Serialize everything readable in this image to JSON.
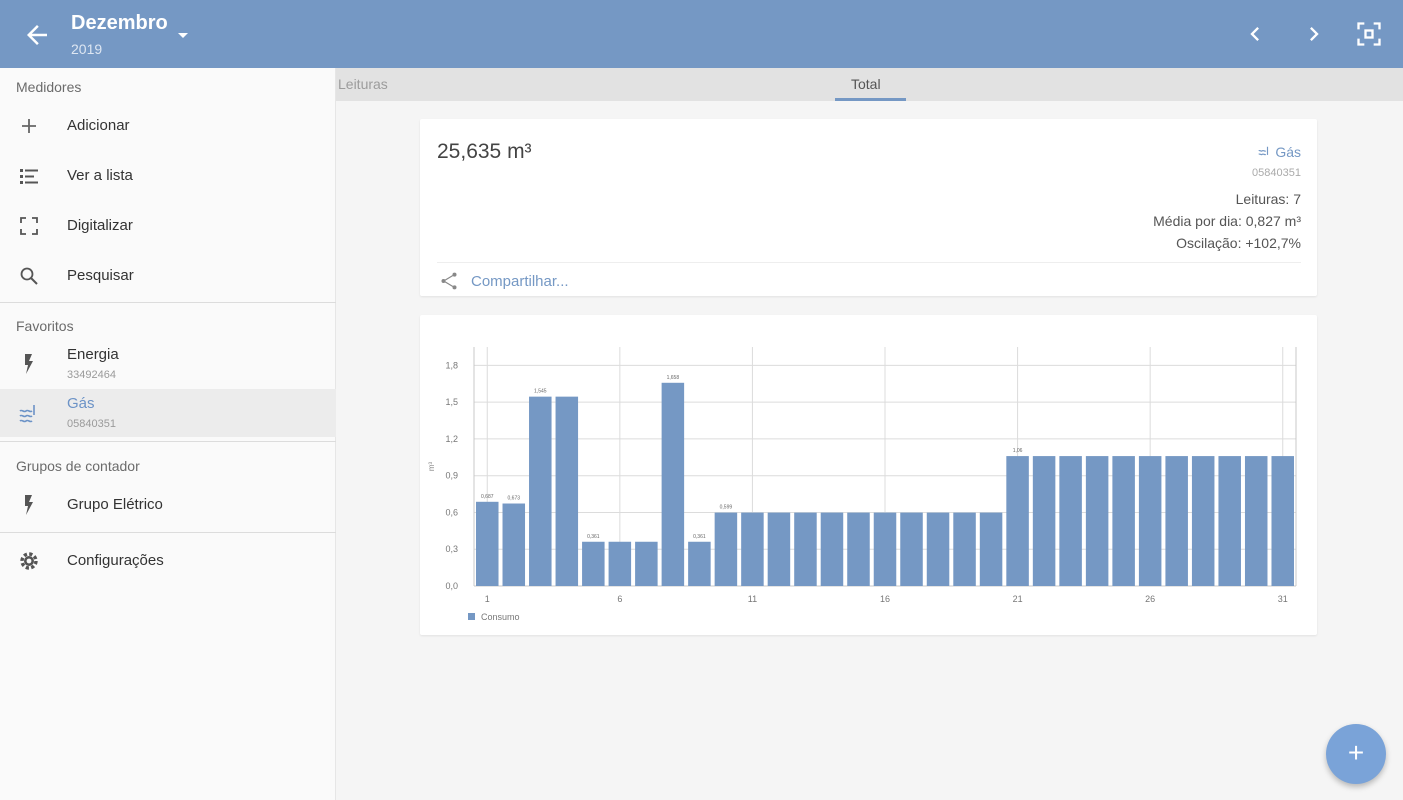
{
  "appbar": {
    "title": "Dezembro",
    "subtitle": "2019",
    "back_icon": "arrow-back-icon",
    "dropdown_icon": "arrow-drop-down-icon",
    "actions": [
      "chevron-left-icon",
      "chevron-right-icon",
      "scan-icon"
    ],
    "color": "#7598c4"
  },
  "drawer": {
    "meters_label": "Medidores",
    "meters_items": [
      {
        "label": "Adicionar",
        "icon": "plus-icon"
      },
      {
        "label": "Ver a lista",
        "icon": "list-icon"
      },
      {
        "label": "Digitalizar",
        "icon": "scan-frame-icon"
      },
      {
        "label": "Pesquisar",
        "icon": "search-icon"
      }
    ],
    "favorites_label": "Favoritos",
    "favorites": [
      {
        "label": "Energia",
        "sub": "33492464",
        "icon": "bolt-icon",
        "active": false
      },
      {
        "label": "Gás",
        "sub": "05840351",
        "icon": "gas-icon",
        "active": true
      }
    ],
    "groups_label": "Grupos de contador",
    "groups": [
      {
        "label": "Grupo Elétrico",
        "icon": "bolt-icon"
      }
    ],
    "settings": {
      "label": "Configurações",
      "icon": "gear-icon"
    }
  },
  "tabs": [
    {
      "label": "Leituras",
      "active": false
    },
    {
      "label": "Total",
      "active": true
    }
  ],
  "summary": {
    "total": "25,635 m³",
    "meter_type": "Gás",
    "meter_number": "05840351",
    "readings": "Leituras: 7",
    "avg_per_day": "Média por dia: 0,827 m³",
    "oscillation": "Oscilação: +102,7%",
    "share_label": "Compartilhar..."
  },
  "chart_data": {
    "type": "bar",
    "x": [
      1,
      2,
      3,
      4,
      5,
      6,
      7,
      8,
      9,
      10,
      11,
      12,
      13,
      14,
      15,
      16,
      17,
      18,
      19,
      20,
      21,
      22,
      23,
      24,
      25,
      26,
      27,
      28,
      29,
      30,
      31
    ],
    "series": [
      {
        "name": "Consumo",
        "values": [
          0.687,
          0.673,
          1.545,
          1.545,
          0.361,
          0.361,
          0.361,
          1.658,
          0.361,
          0.599,
          0.599,
          0.599,
          0.599,
          0.599,
          0.599,
          0.599,
          0.599,
          0.599,
          0.599,
          0.599,
          1.06,
          1.06,
          1.06,
          1.06,
          1.06,
          1.06,
          1.06,
          1.06,
          1.06,
          1.06,
          1.06
        ]
      }
    ],
    "data_labels": [
      {
        "day": 1,
        "text": "0,687"
      },
      {
        "day": 2,
        "text": "0,673"
      },
      {
        "day": 3,
        "text": "1,545"
      },
      {
        "day": 5,
        "text": "0,361"
      },
      {
        "day": 8,
        "text": "1,658"
      },
      {
        "day": 9,
        "text": "0,361"
      },
      {
        "day": 10,
        "text": "0,599"
      },
      {
        "day": 21,
        "text": "1,06"
      }
    ],
    "ylabel": "m³",
    "ylim": [
      0,
      1.95
    ],
    "yticks": [
      "0,0",
      "0,3",
      "0,6",
      "0,9",
      "1,2",
      "1,5",
      "1,8"
    ],
    "xticks": [
      1,
      6,
      11,
      16,
      21,
      26,
      31
    ],
    "grid": true,
    "legend_position": "bottom-left",
    "bar_color": "#7598c4"
  },
  "fab": {
    "label": "+",
    "icon": "plus-icon"
  }
}
